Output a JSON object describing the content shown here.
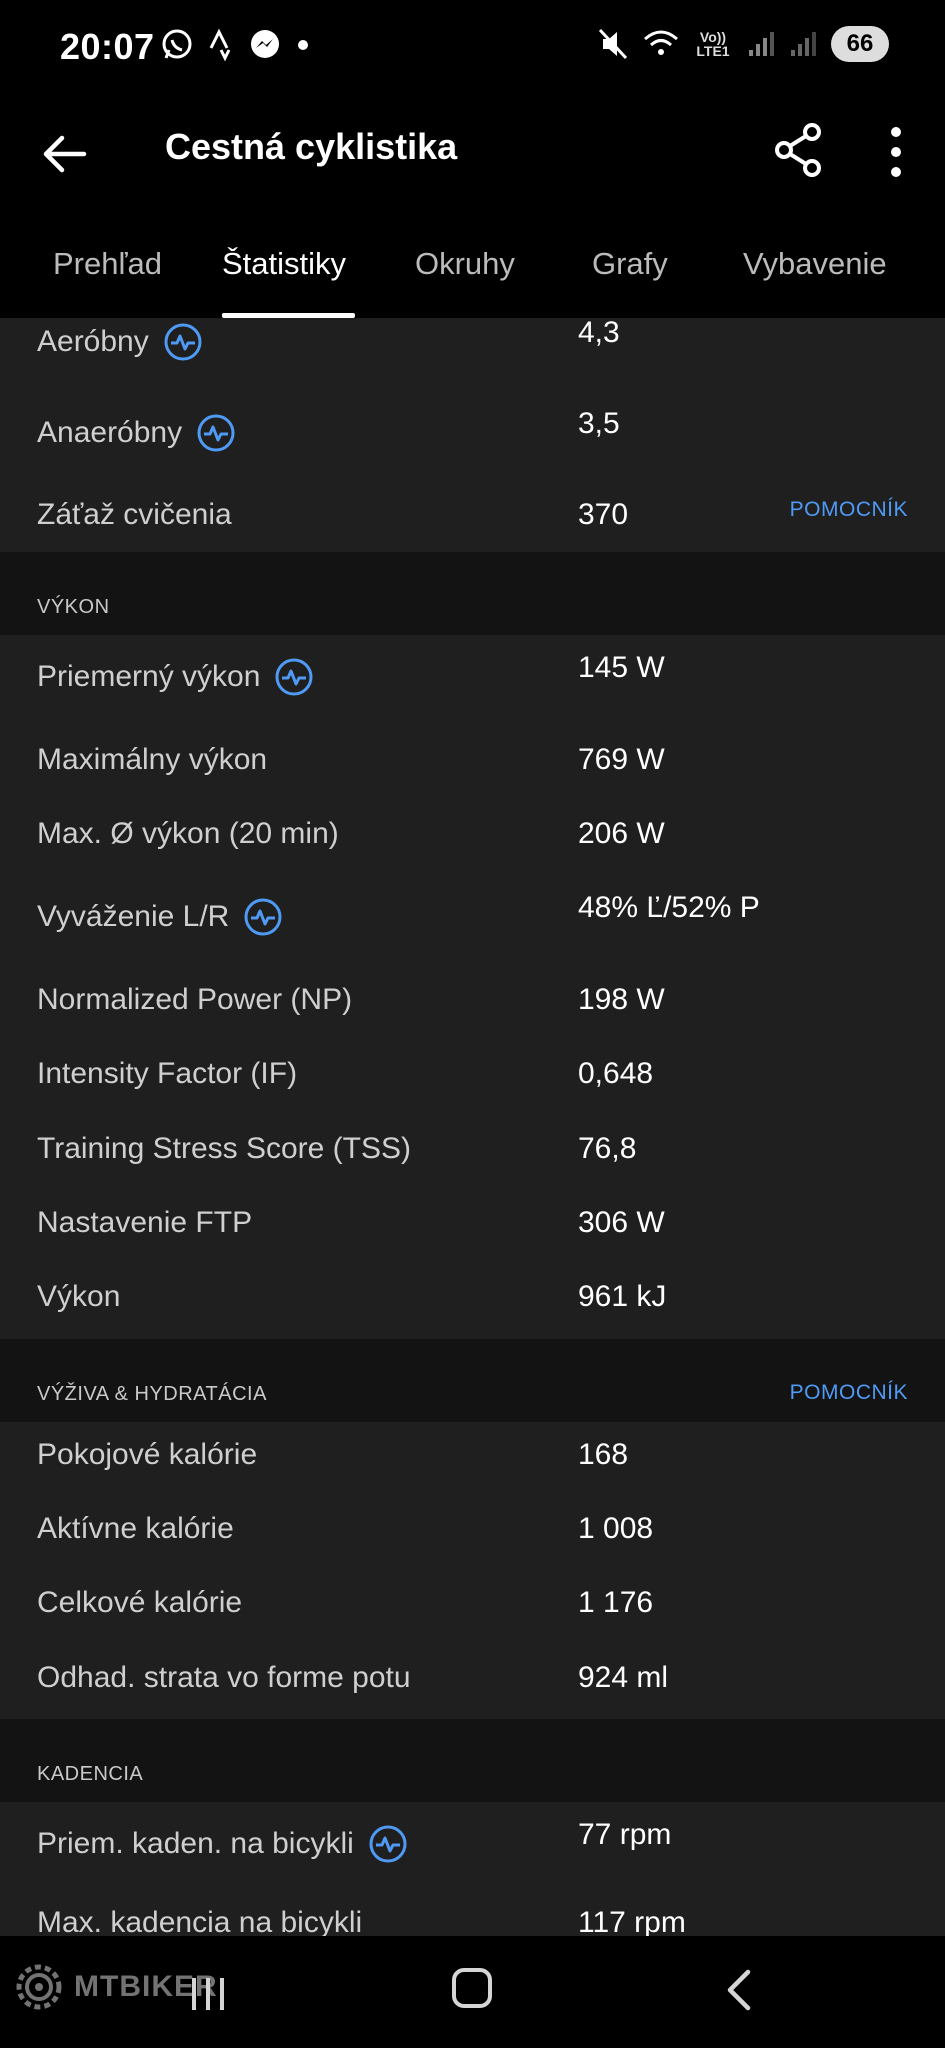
{
  "status_bar": {
    "time": "20:07",
    "signal_text": "Vo)) LTE1",
    "battery": "66"
  },
  "app_bar": {
    "title": "Cestná cyklistika"
  },
  "tabs": [
    {
      "label": "Prehľad",
      "active": false
    },
    {
      "label": "Štatistiky",
      "active": true
    },
    {
      "label": "Okruhy",
      "active": false
    },
    {
      "label": "Grafy",
      "active": false
    },
    {
      "label": "Vybavenie",
      "active": false
    }
  ],
  "training": {
    "rows": [
      {
        "label": "Aeróbny",
        "value": "4,3"
      },
      {
        "label": "Anaeróbny",
        "value": "3,5"
      },
      {
        "label": "Záťaž cvičenia",
        "value": "370"
      }
    ],
    "helper": "POMOCNÍK"
  },
  "power": {
    "title": "VÝKON",
    "rows": [
      {
        "label": "Priemerný výkon",
        "value": "145 W"
      },
      {
        "label": "Maximálny výkon",
        "value": "769 W"
      },
      {
        "label": "Max. Ø výkon (20 min)",
        "value": "206 W"
      },
      {
        "label": "Vyváženie L/R",
        "value": "48% Ľ/52% P"
      },
      {
        "label": "Normalized Power (NP)",
        "value": "198 W"
      },
      {
        "label": "Intensity Factor (IF)",
        "value": "0,648"
      },
      {
        "label": "Training Stress Score (TSS)",
        "value": "76,8"
      },
      {
        "label": "Nastavenie FTP",
        "value": "306 W"
      },
      {
        "label": "Výkon",
        "value": "961 kJ"
      }
    ]
  },
  "nutrition": {
    "title": "VÝŽIVA & HYDRATÁCIA",
    "helper": "POMOCNÍK",
    "rows": [
      {
        "label": "Pokojové kalórie",
        "value": "168"
      },
      {
        "label": "Aktívne kalórie",
        "value": "1 008"
      },
      {
        "label": "Celkové kalórie",
        "value": "1 176"
      },
      {
        "label": "Odhad. strata vo forme potu",
        "value": "924 ml"
      }
    ]
  },
  "cadence": {
    "title": "KADENCIA",
    "rows": [
      {
        "label": "Priem. kaden. na bicykli",
        "value": "77 rpm"
      },
      {
        "label": "Max. kadencia na bicykli",
        "value": "117 rpm"
      }
    ]
  },
  "watermark": "MTBIKER",
  "colors": {
    "accent": "#4f9af5",
    "card": "#1f1f1f",
    "section": "#131313"
  },
  "icons": {
    "info": "info-pulse-icon",
    "back": "arrow-left-icon",
    "share": "share-icon",
    "more": "more-vertical-icon"
  }
}
